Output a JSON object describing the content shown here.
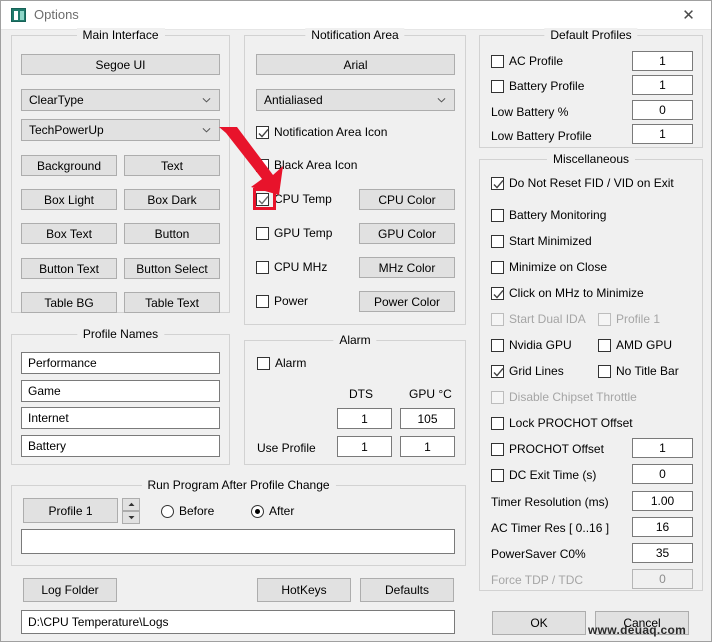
{
  "window": {
    "title": "Options",
    "icon": "app-icon",
    "close_label": "✕"
  },
  "main_interface": {
    "legend": "Main Interface",
    "font_button": "Segoe UI",
    "rendering_combo": "ClearType",
    "theme_combo": "TechPowerUp",
    "color_buttons": [
      "Background",
      "Text",
      "Box Light",
      "Box Dark",
      "Box Text",
      "Button",
      "Button Text",
      "Button Select",
      "Table BG",
      "Table Text"
    ]
  },
  "profile_names": {
    "legend": "Profile Names",
    "values": [
      "Performance",
      "Game",
      "Internet",
      "Battery"
    ]
  },
  "run_program": {
    "legend": "Run Program After Profile Change",
    "profile_button": "Profile 1",
    "before_label": "Before",
    "after_label": "After",
    "before_selected": false,
    "after_selected": true,
    "path_value": ""
  },
  "bottom_left": {
    "log_folder": "Log Folder",
    "hotkeys": "HotKeys",
    "defaults": "Defaults",
    "log_path": "D:\\CPU Temperature\\Logs"
  },
  "notification_area": {
    "legend": "Notification Area",
    "font_button": "Arial",
    "rendering_combo": "Antialiased",
    "checks": [
      {
        "label": "Notification Area Icon",
        "checked": true
      },
      {
        "label": "Black Area Icon",
        "checked": false
      },
      {
        "label": "CPU Temp",
        "checked": true
      },
      {
        "label": "GPU Temp",
        "checked": false
      },
      {
        "label": "CPU MHz",
        "checked": false
      },
      {
        "label": "Power",
        "checked": false
      }
    ],
    "color_buttons": [
      "CPU Color",
      "GPU Color",
      "MHz Color",
      "Power Color"
    ]
  },
  "alarm": {
    "legend": "Alarm",
    "alarm_check": {
      "label": "Alarm",
      "checked": false
    },
    "col_dts": "DTS",
    "col_gpu": "GPU °C",
    "threshold_dts": "1",
    "threshold_gpu": "105",
    "use_profile_label": "Use Profile",
    "use_profile_dts": "1",
    "use_profile_gpu": "1"
  },
  "default_profiles": {
    "legend": "Default Profiles",
    "rows": [
      {
        "label": "AC Profile",
        "type": "check",
        "checked": false,
        "value": "1"
      },
      {
        "label": "Battery Profile",
        "type": "check",
        "checked": false,
        "value": "1"
      },
      {
        "label": "Low Battery %",
        "type": "label",
        "value": "0"
      },
      {
        "label": "Low Battery Profile",
        "type": "label",
        "value": "1"
      }
    ]
  },
  "miscellaneous": {
    "legend": "Miscellaneous",
    "checks": [
      {
        "label": "Do Not Reset FID / VID on Exit",
        "checked": true,
        "disabled": false
      },
      {
        "label": "Battery Monitoring",
        "checked": false,
        "disabled": false
      },
      {
        "label": "Start Minimized",
        "checked": false,
        "disabled": false
      },
      {
        "label": "Minimize on Close",
        "checked": false,
        "disabled": false
      },
      {
        "label": "Click on MHz to Minimize",
        "checked": true,
        "disabled": false
      },
      {
        "label": "Start Dual IDA",
        "checked": false,
        "disabled": true
      },
      {
        "label": "Profile 1",
        "checked": false,
        "disabled": true
      },
      {
        "label": "Nvidia GPU",
        "checked": false,
        "disabled": false
      },
      {
        "label": "AMD GPU",
        "checked": false,
        "disabled": false
      },
      {
        "label": "Grid Lines",
        "checked": true,
        "disabled": false
      },
      {
        "label": "No Title Bar",
        "checked": false,
        "disabled": false
      },
      {
        "label": "Disable Chipset Throttle",
        "checked": false,
        "disabled": true
      },
      {
        "label": "Lock PROCHOT Offset",
        "checked": false,
        "disabled": false
      },
      {
        "label": "PROCHOT Offset",
        "checked": false,
        "disabled": false
      },
      {
        "label": "DC Exit Time (s)",
        "checked": false,
        "disabled": false
      }
    ],
    "values": {
      "prochot_offset": "1",
      "dc_exit_time": "0",
      "timer_resolution": "1.00",
      "ac_timer_res": "16",
      "powersaver_c0": "35",
      "force_tdp_tdc": "0"
    },
    "labels": {
      "timer_resolution": "Timer Resolution (ms)",
      "ac_timer_res": "AC Timer Res [ 0..16 ]",
      "powersaver_c0": "PowerSaver C0%",
      "force_tdp_tdc": "Force TDP / TDC"
    }
  },
  "dialog_buttons": {
    "ok": "OK",
    "cancel": "Cancel"
  },
  "annotation": {
    "highlight_target": "CPU Temp checkbox",
    "arrow_color": "#e8132b",
    "box_color": "#e8132b"
  },
  "watermark": {
    "text": "www.deuaq.com"
  }
}
